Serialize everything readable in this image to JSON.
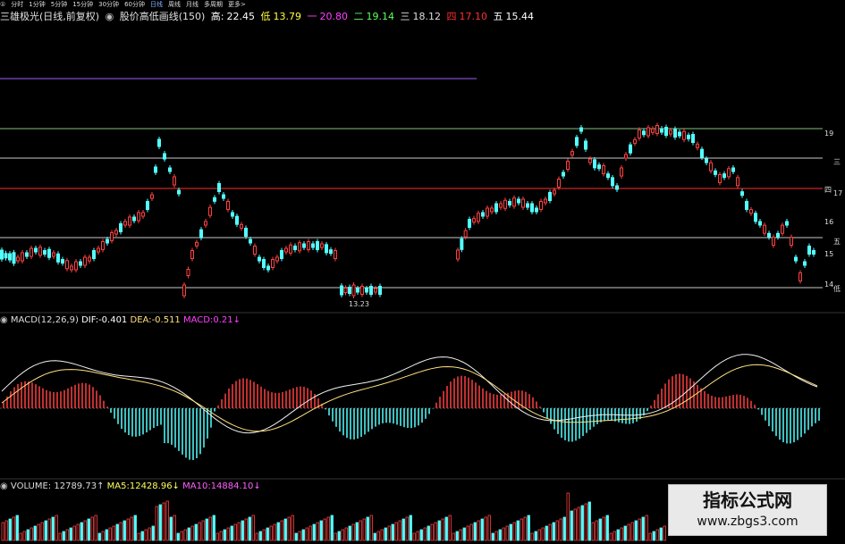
{
  "toolbar": {
    "tabs": [
      "①",
      "分时",
      "1分钟",
      "5分钟",
      "15分钟",
      "30分钟",
      "60分钟",
      "日线",
      "周线",
      "月线",
      "多周期",
      "更多>"
    ],
    "active_index": 7
  },
  "title": {
    "stock": "三雄极光(日线,前复权)",
    "indicator": "股价高低画线(150)",
    "high_label": "高:",
    "high_value": "22.45",
    "low_label": "低",
    "low_value": "13.79",
    "l1_label": "一",
    "l1_value": "20.80",
    "l2_label": "二",
    "l2_value": "19.14",
    "l3_label": "三",
    "l3_value": "18.12",
    "l4_label": "四",
    "l4_value": "17.10",
    "l5_label": "五",
    "l5_value": "15.44"
  },
  "price_axis": [
    "19",
    "三",
    "四",
    "17",
    "16",
    "五",
    "15",
    "低",
    "14"
  ],
  "low_annotation": "13.23",
  "macd": {
    "name": "MACD(12,26,9)",
    "dif_label": "DIF:",
    "dif_value": "-0.401",
    "dea_label": "DEA:",
    "dea_value": "-0.511",
    "macd_label": "MACD:",
    "macd_value": "0.21↓"
  },
  "volume": {
    "name": "VOLUME:",
    "value": "12789.73↑",
    "ma5_label": "MA5:",
    "ma5_value": "12428.96↓",
    "ma10_label": "MA10:",
    "ma10_value": "14884.10↓"
  },
  "watermark": {
    "title": "指标公式网",
    "url": "www.zbgs3.com"
  },
  "colors": {
    "up": "#ff4040",
    "down": "#54ffff",
    "level_white": "#c8c8c8",
    "level_red": "#ff3030",
    "level_green": "#7fc07f",
    "level_purple": "#a060ff",
    "dif": "#f0f0f0",
    "dea": "#ffe080",
    "macd_text": "#ff40ff"
  },
  "icons": {
    "indicator_dot": "circle-icon"
  }
}
